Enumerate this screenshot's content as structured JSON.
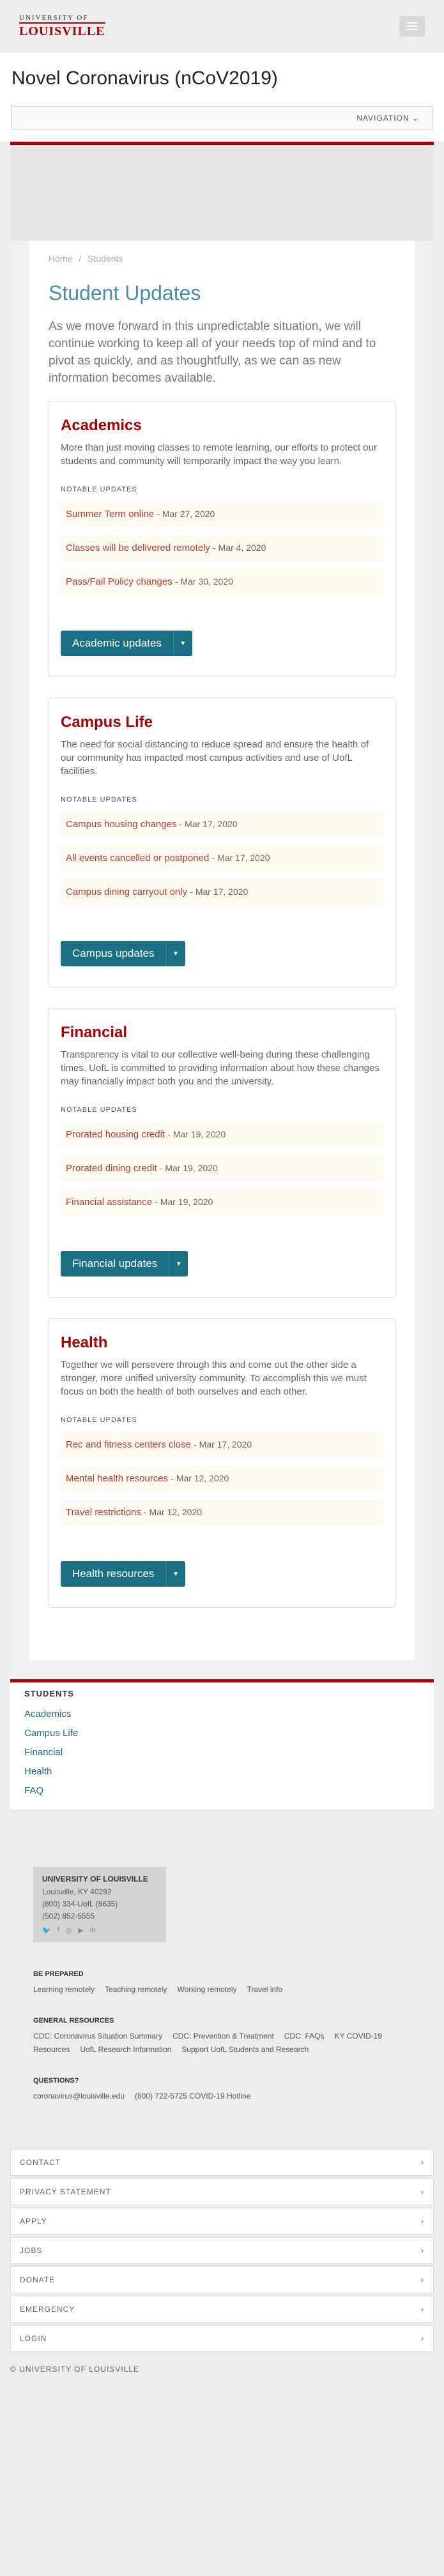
{
  "header": {
    "logo_line1": "UNIVERSITY OF",
    "logo_line2": "LOUISVILLE",
    "title": "Novel Coronavirus (nCoV2019)",
    "nav_label": "NAVIGATION ⌄"
  },
  "breadcrumb": [
    "Home",
    "/",
    "Students"
  ],
  "page": {
    "title": "Student Updates",
    "intro": "As we move forward in this unpredictable situation, we will continue working to keep all of your needs top of mind and to pivot as quickly, and as thoughtfully, as we can as new information becomes available."
  },
  "notable_label": "NOTABLE UPDATES",
  "sections": [
    {
      "title": "Academics",
      "description": "More than just moving classes to remote learning, our efforts to protect our students and community will temporarily impact the way you learn.",
      "updates": [
        {
          "text": "Summer Term online",
          "date": "- Mar 27, 2020"
        },
        {
          "text": "Classes will be delivered remotely",
          "date": "- Mar 4, 2020"
        },
        {
          "text": "Pass/Fail Policy changes",
          "date": "- Mar 30, 2020"
        }
      ],
      "button": "Academic updates"
    },
    {
      "title": "Campus Life",
      "description": "The need for social distancing to reduce spread and ensure the health of our community has impacted most campus activities and use of UofL facilities.",
      "updates": [
        {
          "text": "Campus housing changes",
          "date": "- Mar 17, 2020"
        },
        {
          "text": "All events cancelled or postponed",
          "date": "- Mar 17, 2020"
        },
        {
          "text": "Campus dining carryout only",
          "date": "- Mar 17, 2020"
        }
      ],
      "button": "Campus updates"
    },
    {
      "title": "Financial",
      "description": "Transparency is vital to our collective well-being during these challenging times. UofL is committed to providing information about how these changes may financially impact both you and the university.",
      "updates": [
        {
          "text": "Prorated housing credit",
          "date": "- Mar 19, 2020"
        },
        {
          "text": "Prorated dining credit",
          "date": "- Mar 19, 2020"
        },
        {
          "text": "Financial assistance",
          "date": "- Mar 19, 2020"
        }
      ],
      "button": "Financial updates"
    },
    {
      "title": "Health",
      "description": "Together we will persevere through this and come out the other side a stronger, more unified university community. To accomplish this we must focus on both the health of both ourselves and each other.",
      "updates": [
        {
          "text": "Rec and fitness centers close",
          "date": "- Mar 17, 2020"
        },
        {
          "text": "Mental health resources",
          "date": "- Mar 12, 2020"
        },
        {
          "text": "Travel restrictions",
          "date": "- Mar 12, 2020"
        }
      ],
      "button": "Health resources"
    }
  ],
  "subnav": {
    "title": "STUDENTS",
    "items": [
      "Academics",
      "Campus Life",
      "Financial",
      "Health",
      "FAQ"
    ]
  },
  "footer": {
    "name": "UNIVERSITY OF LOUISVILLE",
    "address": [
      "Louisville, KY 40292",
      "(800) 334-UofL (8635)",
      "(502) 852-5555"
    ],
    "social_icons": [
      "twitter-icon",
      "facebook-icon",
      "instagram-icon",
      "youtube-icon",
      "linkedin-icon"
    ],
    "social_glyphs": [
      "🐦",
      "f",
      "◎",
      "▶",
      "in"
    ],
    "sections": [
      {
        "title": "BE PREPARED",
        "links": [
          "Learning remotely",
          "Teaching remotely",
          "Working remotely",
          "Travel info"
        ]
      },
      {
        "title": "GENERAL RESOURCES",
        "links": [
          "CDC: Coronavirus Situation Summary",
          "CDC: Prevention & Treatment",
          "CDC: FAQs",
          "KY COVID-19 Resources",
          "UofL Research Information",
          "Support UofL Students and Research"
        ]
      },
      {
        "title": "QUESTIONS?",
        "links": [
          "coronavirus@louisville.edu",
          "(800) 722-5725 COVID-19 Hotline"
        ]
      }
    ],
    "fold_items": [
      "CONTACT",
      "PRIVACY STATEMENT",
      "APPLY",
      "JOBS",
      "DONATE",
      "EMERGENCY",
      "LOGIN"
    ],
    "copyright": "© UNIVERSITY OF LOUISVILLE"
  },
  "colors": {
    "accent_red": "#ad0000",
    "teal": "#1b6f82",
    "title_blue": "#4b8da6"
  }
}
